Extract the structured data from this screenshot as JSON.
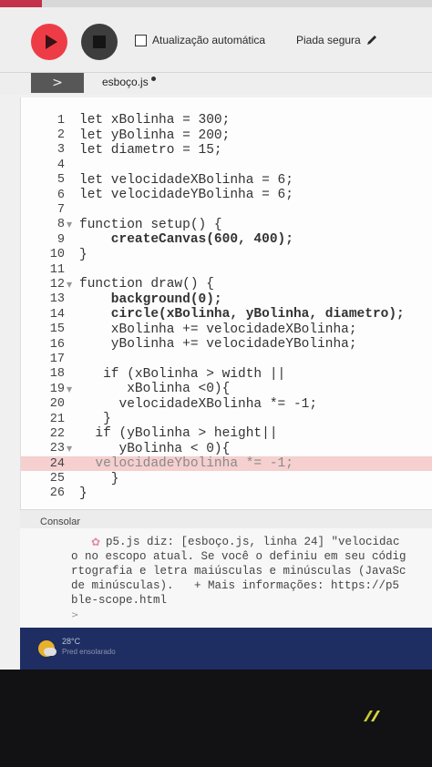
{
  "toolbar": {
    "autorefresh_label": "Atualização automática",
    "project_name": "Piada segura"
  },
  "tab": {
    "sidebar_toggle": ">",
    "filename": "esboço.js"
  },
  "editor": {
    "lines": [
      {
        "n": "1",
        "code": "let xBolinha = 300;"
      },
      {
        "n": "2",
        "code": "let yBolinha = 200;"
      },
      {
        "n": "3",
        "code": "let diametro = 15;"
      },
      {
        "n": "4",
        "code": ""
      },
      {
        "n": "5",
        "code": "let velocidadeXBolinha = 6;"
      },
      {
        "n": "6",
        "code": "let velocidadeYBolinha = 6;"
      },
      {
        "n": "7",
        "code": ""
      },
      {
        "n": "8",
        "code": "function setup() {"
      },
      {
        "n": "9",
        "code": "    createCanvas(600, 400);"
      },
      {
        "n": "10",
        "code": "}"
      },
      {
        "n": "11",
        "code": ""
      },
      {
        "n": "12",
        "code": "function draw() {"
      },
      {
        "n": "13",
        "code": "    background(0);"
      },
      {
        "n": "14",
        "code": "    circle(xBolinha, yBolinha, diametro);"
      },
      {
        "n": "15",
        "code": "    xBolinha += velocidadeXBolinha;"
      },
      {
        "n": "16",
        "code": "    yBolinha += velocidadeYBolinha;"
      },
      {
        "n": "17",
        "code": ""
      },
      {
        "n": "18",
        "code": "   if (xBolinha > width ||"
      },
      {
        "n": "19",
        "code": "      xBolinha <0){"
      },
      {
        "n": "20",
        "code": "     velocidadeXBolinha *= -1;"
      },
      {
        "n": "21",
        "code": "   }"
      },
      {
        "n": "22",
        "code": "  if (yBolinha > height||"
      },
      {
        "n": "23",
        "code": "     yBolinha < 0){"
      },
      {
        "n": "24",
        "code": "  velocidadeYbolinha *= -1;"
      },
      {
        "n": "25",
        "code": "    }"
      },
      {
        "n": "26",
        "code": "}"
      }
    ]
  },
  "console": {
    "title": "Consolar",
    "output": [
      "p5.js diz: [esboço.js, linha 24] \"velocidac",
      "o no escopo atual. Se você o definiu em seu códig",
      "rtografia e letra maiúsculas e minúsculas (JavaSc",
      "de minúsculas).   + Mais informações: https://p5",
      "ble-scope.html"
    ],
    "prompt": ">"
  },
  "taskbar": {
    "temperature": "28°C",
    "weather": "Pred ensolarado"
  }
}
